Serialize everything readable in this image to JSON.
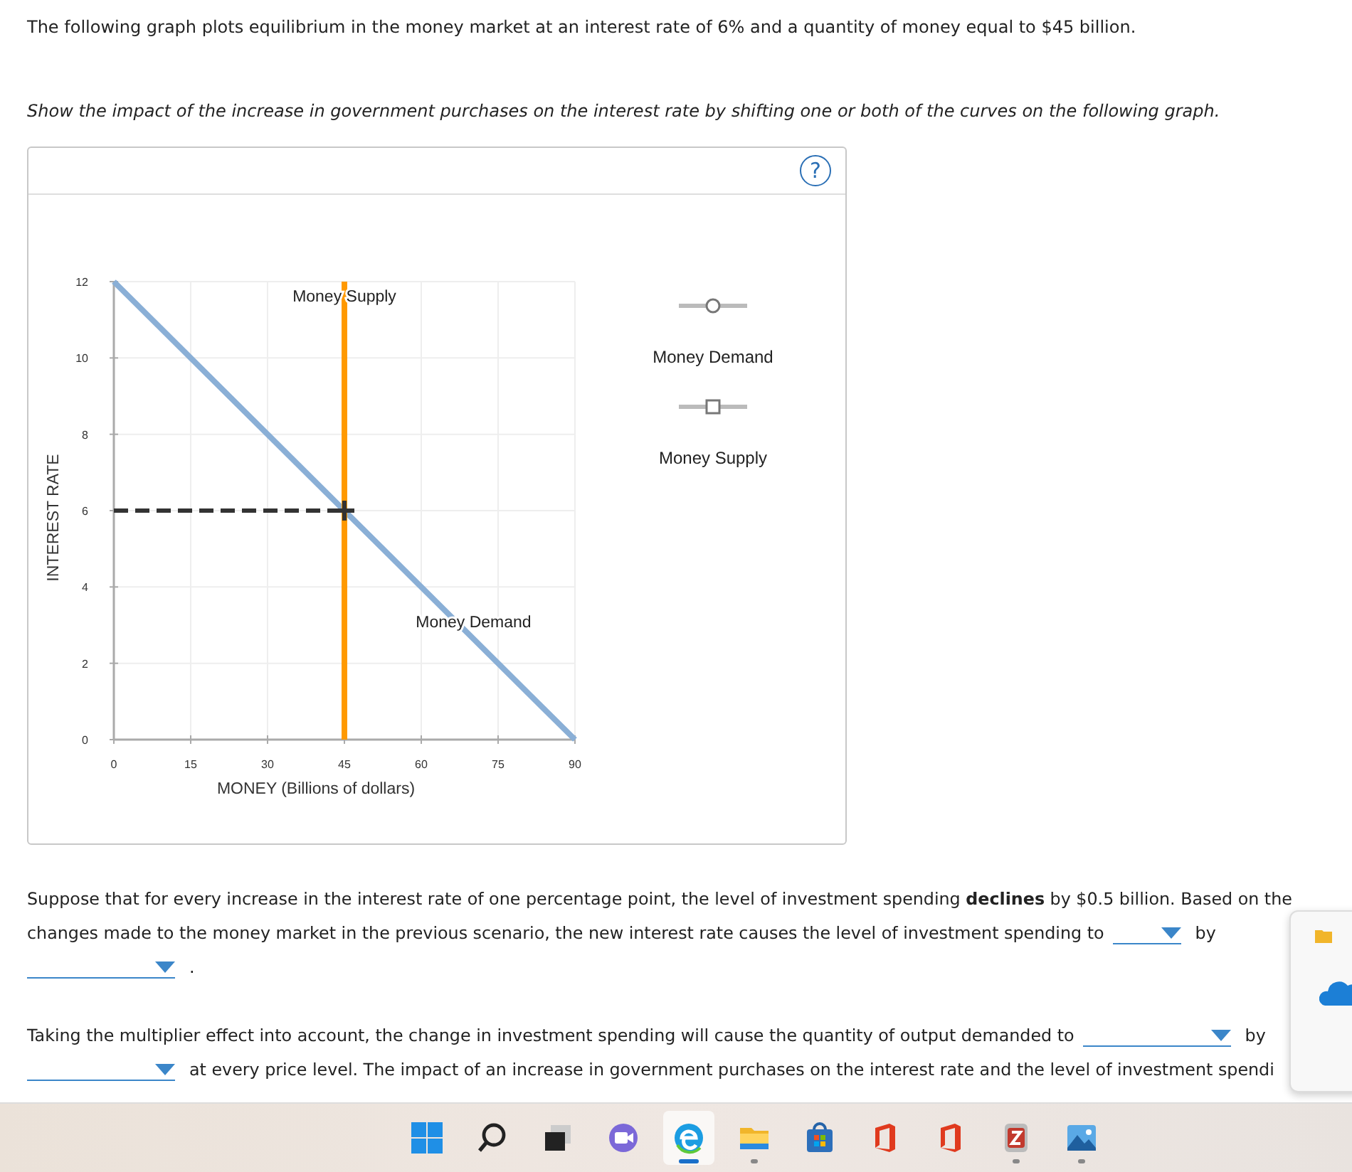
{
  "intro": "The following graph plots equilibrium in the money market at an interest rate of 6% and a quantity of money equal to $45 billion.",
  "instruction": "Show the impact of the increase in government purchases on the interest rate by shifting one or both of the curves on the following graph.",
  "graph_panel": {
    "help_button": "?",
    "chart_data": {
      "type": "line",
      "xlabel": "MONEY (Billions of dollars)",
      "ylabel": "INTEREST RATE",
      "xlim": [
        0,
        90
      ],
      "ylim": [
        0,
        12
      ],
      "xticks": [
        0,
        15,
        30,
        45,
        60,
        75,
        90
      ],
      "yticks": [
        0,
        2,
        4,
        6,
        8,
        10,
        12
      ],
      "grid": true,
      "series": [
        {
          "name": "Money Demand",
          "color": "#8aafd6",
          "x": [
            0,
            90
          ],
          "values": [
            12,
            0
          ]
        },
        {
          "name": "Money Supply",
          "color": "#ff9900",
          "x": [
            45,
            45
          ],
          "values": [
            0,
            12
          ]
        }
      ],
      "ref_lines": [
        {
          "axis": "y",
          "value": 6
        }
      ]
    },
    "legend": [
      {
        "label": "Money Demand",
        "kind": "circle"
      },
      {
        "label": "Money Supply",
        "kind": "square"
      }
    ]
  },
  "paragraphs": [
    {
      "lines": [
        [
          {
            "kind": "text",
            "text": "Suppose that for every increase in the interest rate of one percentage point, the level of investment spending **declines** by $0.5 billion. Based on the"
          }
        ],
        [
          {
            "kind": "text",
            "text": "changes made to the money market in the previous scenario, the new interest rate causes the level of investment spending to"
          },
          {
            "kind": "minidropdown"
          },
          {
            "kind": "text",
            "text": "by"
          }
        ],
        [
          {
            "kind": "dropdown"
          },
          {
            "kind": "text",
            "text": "."
          }
        ]
      ]
    },
    {
      "lines": [
        [
          {
            "kind": "text",
            "text": "Taking the multiplier effect into account, the change in investment spending will cause the quantity of output demanded to"
          },
          {
            "kind": "dropdown"
          },
          {
            "kind": "text",
            "text": "by"
          }
        ],
        [
          {
            "kind": "dropdown"
          },
          {
            "kind": "text",
            "text": "at every price level. The impact of an increase in government purchases on the interest rate and the level of investment spendi"
          }
        ]
      ]
    }
  ],
  "taskbar": [
    {
      "kind": "windows",
      "running": false,
      "selected": false
    },
    {
      "kind": "search",
      "running": false,
      "selected": false
    },
    {
      "kind": "taskview",
      "running": false,
      "selected": false
    },
    {
      "kind": "chat",
      "running": false,
      "selected": false
    },
    {
      "kind": "edge",
      "running": true,
      "selected": true
    },
    {
      "kind": "folder",
      "running": true,
      "selected": false
    },
    {
      "kind": "store",
      "running": false,
      "selected": false
    },
    {
      "kind": "office",
      "running": false,
      "selected": false
    },
    {
      "kind": "office",
      "running": false,
      "selected": false
    },
    {
      "kind": "archive",
      "running": true,
      "selected": false
    },
    {
      "kind": "photos",
      "running": true,
      "selected": false
    }
  ]
}
